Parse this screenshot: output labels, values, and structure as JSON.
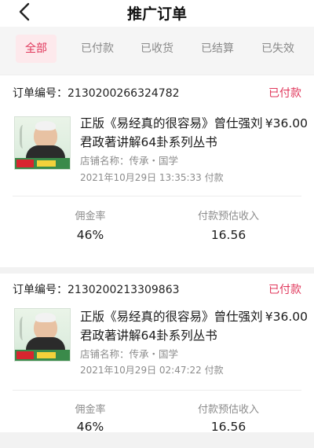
{
  "header": {
    "title": "推广订单",
    "back_icon": "chevron-left-icon"
  },
  "tabs": [
    {
      "label": "全部",
      "active": true
    },
    {
      "label": "已付款",
      "active": false
    },
    {
      "label": "已收货",
      "active": false
    },
    {
      "label": "已结算",
      "active": false
    },
    {
      "label": "已失效",
      "active": false
    }
  ],
  "orders": [
    {
      "order_label": "订单编号：",
      "order_no": "2130200266324782",
      "status": "已付款",
      "product_title_line1": "正版《易经真的很容易》曾仕强刘",
      "price": "¥36.00",
      "product_title_line2": "君政著讲解64卦系列丛书",
      "shop": "店铺名称：传承・国学",
      "paid_time": "2021年10月29日 13:35:33 付款",
      "commission_label": "佣金率",
      "commission_value": "46%",
      "income_label": "付款预估收入",
      "income_value": "16.56"
    },
    {
      "order_label": "订单编号：",
      "order_no": "2130200213309863",
      "status": "已付款",
      "product_title_line1": "正版《易经真的很容易》曾仕强刘",
      "price": "¥36.00",
      "product_title_line2": "君政著讲解64卦系列丛书",
      "shop": "店铺名称：传承・国学",
      "paid_time": "2021年10月29日 02:47:22 付款",
      "commission_label": "佣金率",
      "commission_value": "46%",
      "income_label": "付款预估收入",
      "income_value": "16.56"
    }
  ],
  "colors": {
    "accent": "#e0375b",
    "accent_bg": "#fde9ec",
    "muted": "#8c8c8c"
  }
}
